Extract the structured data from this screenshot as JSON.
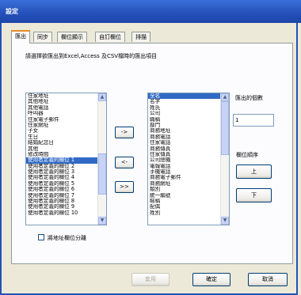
{
  "window": {
    "title": "設定"
  },
  "tabs": [
    "匯出",
    "同步",
    "欄位顯示",
    "自訂欄位",
    "排描"
  ],
  "instruction": "請選擇欲匯出到Excel,Access 及CSV檔時的匯出項目",
  "left_list": [
    "住家地址",
    "其他地址",
    "其他電話",
    "呼叫器",
    "住家電子郵件",
    "住家網址",
    "子女",
    "生日",
    "結婚紀念日",
    "其他",
    "修改時間",
    "使用者定義的欄位 1",
    "使用者定義的欄位 2",
    "使用者定義的欄位 3",
    "使用者定義的欄位 4",
    "使用者定義的欄位 5",
    "使用者定義的欄位 6",
    "使用者定義的欄位 7",
    "使用者定義的欄位 8",
    "使用者定義的欄位 9",
    "使用者定義的欄位 10"
  ],
  "left_selected_index": 11,
  "right_list": [
    "全名",
    "名字",
    "姓氏",
    "公司",
    "職稱",
    "部門",
    "商務地址",
    "商務電話",
    "住家電話",
    "商務傳真",
    "住家傳真",
    "公司總機",
    "電報電話",
    "手機電話",
    "商務電子郵件",
    "商務網址",
    "類別",
    "統一編號",
    "暱稱",
    "配偶",
    "姓別"
  ],
  "right_selected_index": 0,
  "move_buttons": [
    "->",
    "<-",
    ">>"
  ],
  "count_label": "匯出的個數",
  "count_value": "1",
  "order_label": "欄位順序",
  "up_label": "上",
  "down_label": "下",
  "split_address_label": "將地址欄位分離",
  "split_address_checked": false,
  "footer": {
    "apply": "套用",
    "ok": "確定",
    "cancel": "取消"
  }
}
